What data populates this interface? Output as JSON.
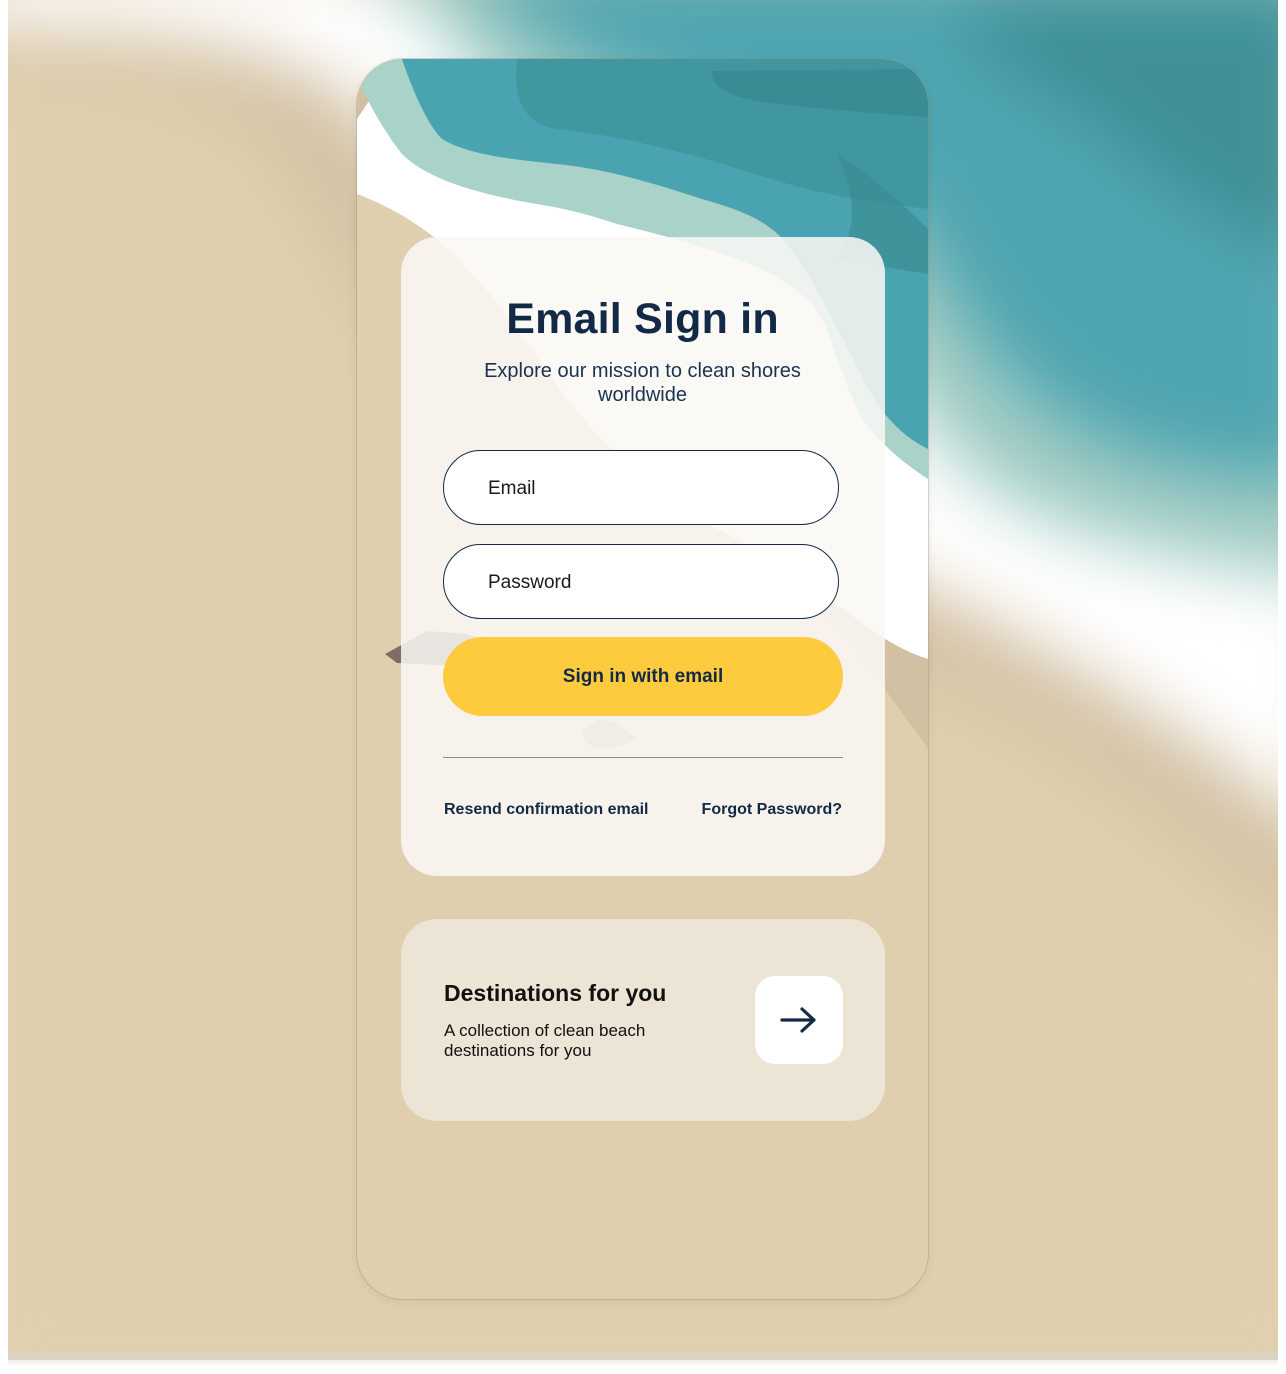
{
  "signin": {
    "title": "Email Sign in",
    "subtitle": "Explore our mission to clean shores worldwide",
    "email_placeholder": "Email",
    "password_placeholder": "Password",
    "submit_label": "Sign in with email",
    "resend_link": "Resend confirmation email",
    "forgot_link": "Forgot Password?"
  },
  "destinations": {
    "title": "Destinations for you",
    "description": "A collection of clean beach destinations for you",
    "action_icon": "arrow-right-icon"
  },
  "colors": {
    "primary_button": "#ffcb3e",
    "text_dark": "#132a47",
    "sand": "#dfcfae",
    "ocean": "#4aa3b0",
    "foam": "#a9d2c9",
    "card": "#faf8f4"
  }
}
